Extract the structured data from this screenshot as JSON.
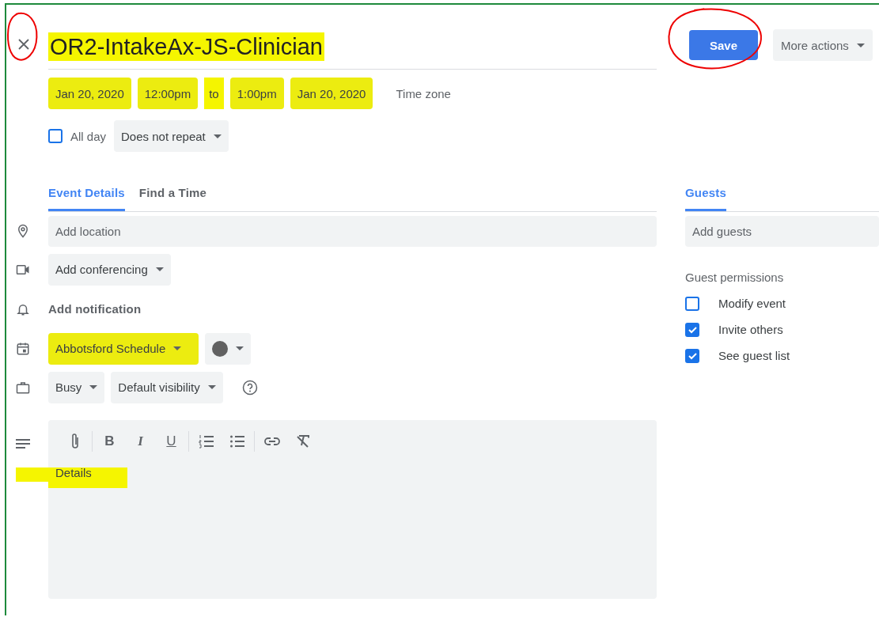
{
  "close_button": {
    "annotated": true
  },
  "title": {
    "text": "OR2-IntakeAx-JS-Clinician",
    "highlighted": true
  },
  "save_button": {
    "label": "Save",
    "annotated": true
  },
  "more_actions": {
    "label": "More actions"
  },
  "date_row": {
    "highlighted": true,
    "start_date": "Jan 20, 2020",
    "start_time": "12:00pm",
    "separator": "to",
    "end_time": "1:00pm",
    "end_date": "Jan 20, 2020",
    "time_zone": "Time zone"
  },
  "all_day": {
    "label": "All day",
    "checked": false
  },
  "repeat": {
    "label": "Does not repeat"
  },
  "tabs": [
    {
      "label": "Event Details",
      "selected": true
    },
    {
      "label": "Find a Time",
      "selected": false
    }
  ],
  "location": {
    "placeholder": "Add location"
  },
  "conferencing": {
    "label": "Add conferencing"
  },
  "notification": {
    "label": "Add notification"
  },
  "calendar": {
    "label": "Abbotsford Schedule",
    "highlighted": true,
    "color": "#616161"
  },
  "availability": {
    "label": "Busy"
  },
  "visibility": {
    "label": "Default visibility"
  },
  "description": {
    "placeholder": "Details",
    "highlighted": true,
    "toolbar": [
      {
        "kind": "attach"
      },
      {
        "kind": "divider"
      },
      {
        "kind": "bold",
        "label": "B"
      },
      {
        "kind": "italic",
        "label": "I"
      },
      {
        "kind": "underline",
        "label": "U"
      },
      {
        "kind": "divider"
      },
      {
        "kind": "numbered"
      },
      {
        "kind": "bulleted"
      },
      {
        "kind": "divider"
      },
      {
        "kind": "link"
      },
      {
        "kind": "clear"
      }
    ]
  },
  "guests_tab": {
    "label": "Guests",
    "selected": true
  },
  "add_guests": {
    "placeholder": "Add guests"
  },
  "permissions": {
    "title": "Guest permissions",
    "items": [
      {
        "label": "Modify event",
        "checked": false
      },
      {
        "label": "Invite others",
        "checked": true
      },
      {
        "label": "See guest list",
        "checked": true
      }
    ]
  }
}
